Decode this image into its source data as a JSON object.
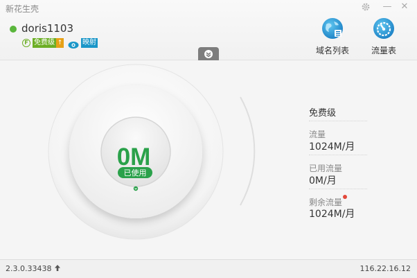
{
  "window": {
    "title": "新花生壳",
    "minimize_glyph": "—",
    "close_glyph": "✕"
  },
  "user": {
    "name": "doris1103",
    "online_color": "#5ab63c",
    "f_badge": "F",
    "level_badge": "免费级",
    "upgrade_glyph": "↑",
    "mapping_badge": "映射"
  },
  "toolbar": {
    "domains_label": "域名列表",
    "traffic_label": "流量表"
  },
  "gauge": {
    "used_value": "0M",
    "used_label": "已使用",
    "used_fraction": 0,
    "accent_color": "#2aa14a"
  },
  "stats": {
    "level": "免费级",
    "traffic_label": "流量",
    "traffic_value": "1024M/月",
    "used_label": "已用流量",
    "used_value": "0M/月",
    "remaining_label": "剩余流量",
    "remaining_value": "1024M/月"
  },
  "footer": {
    "version": "2.3.0.33438",
    "upgrade_glyph": "🡅",
    "ip": "116.22.16.12"
  }
}
